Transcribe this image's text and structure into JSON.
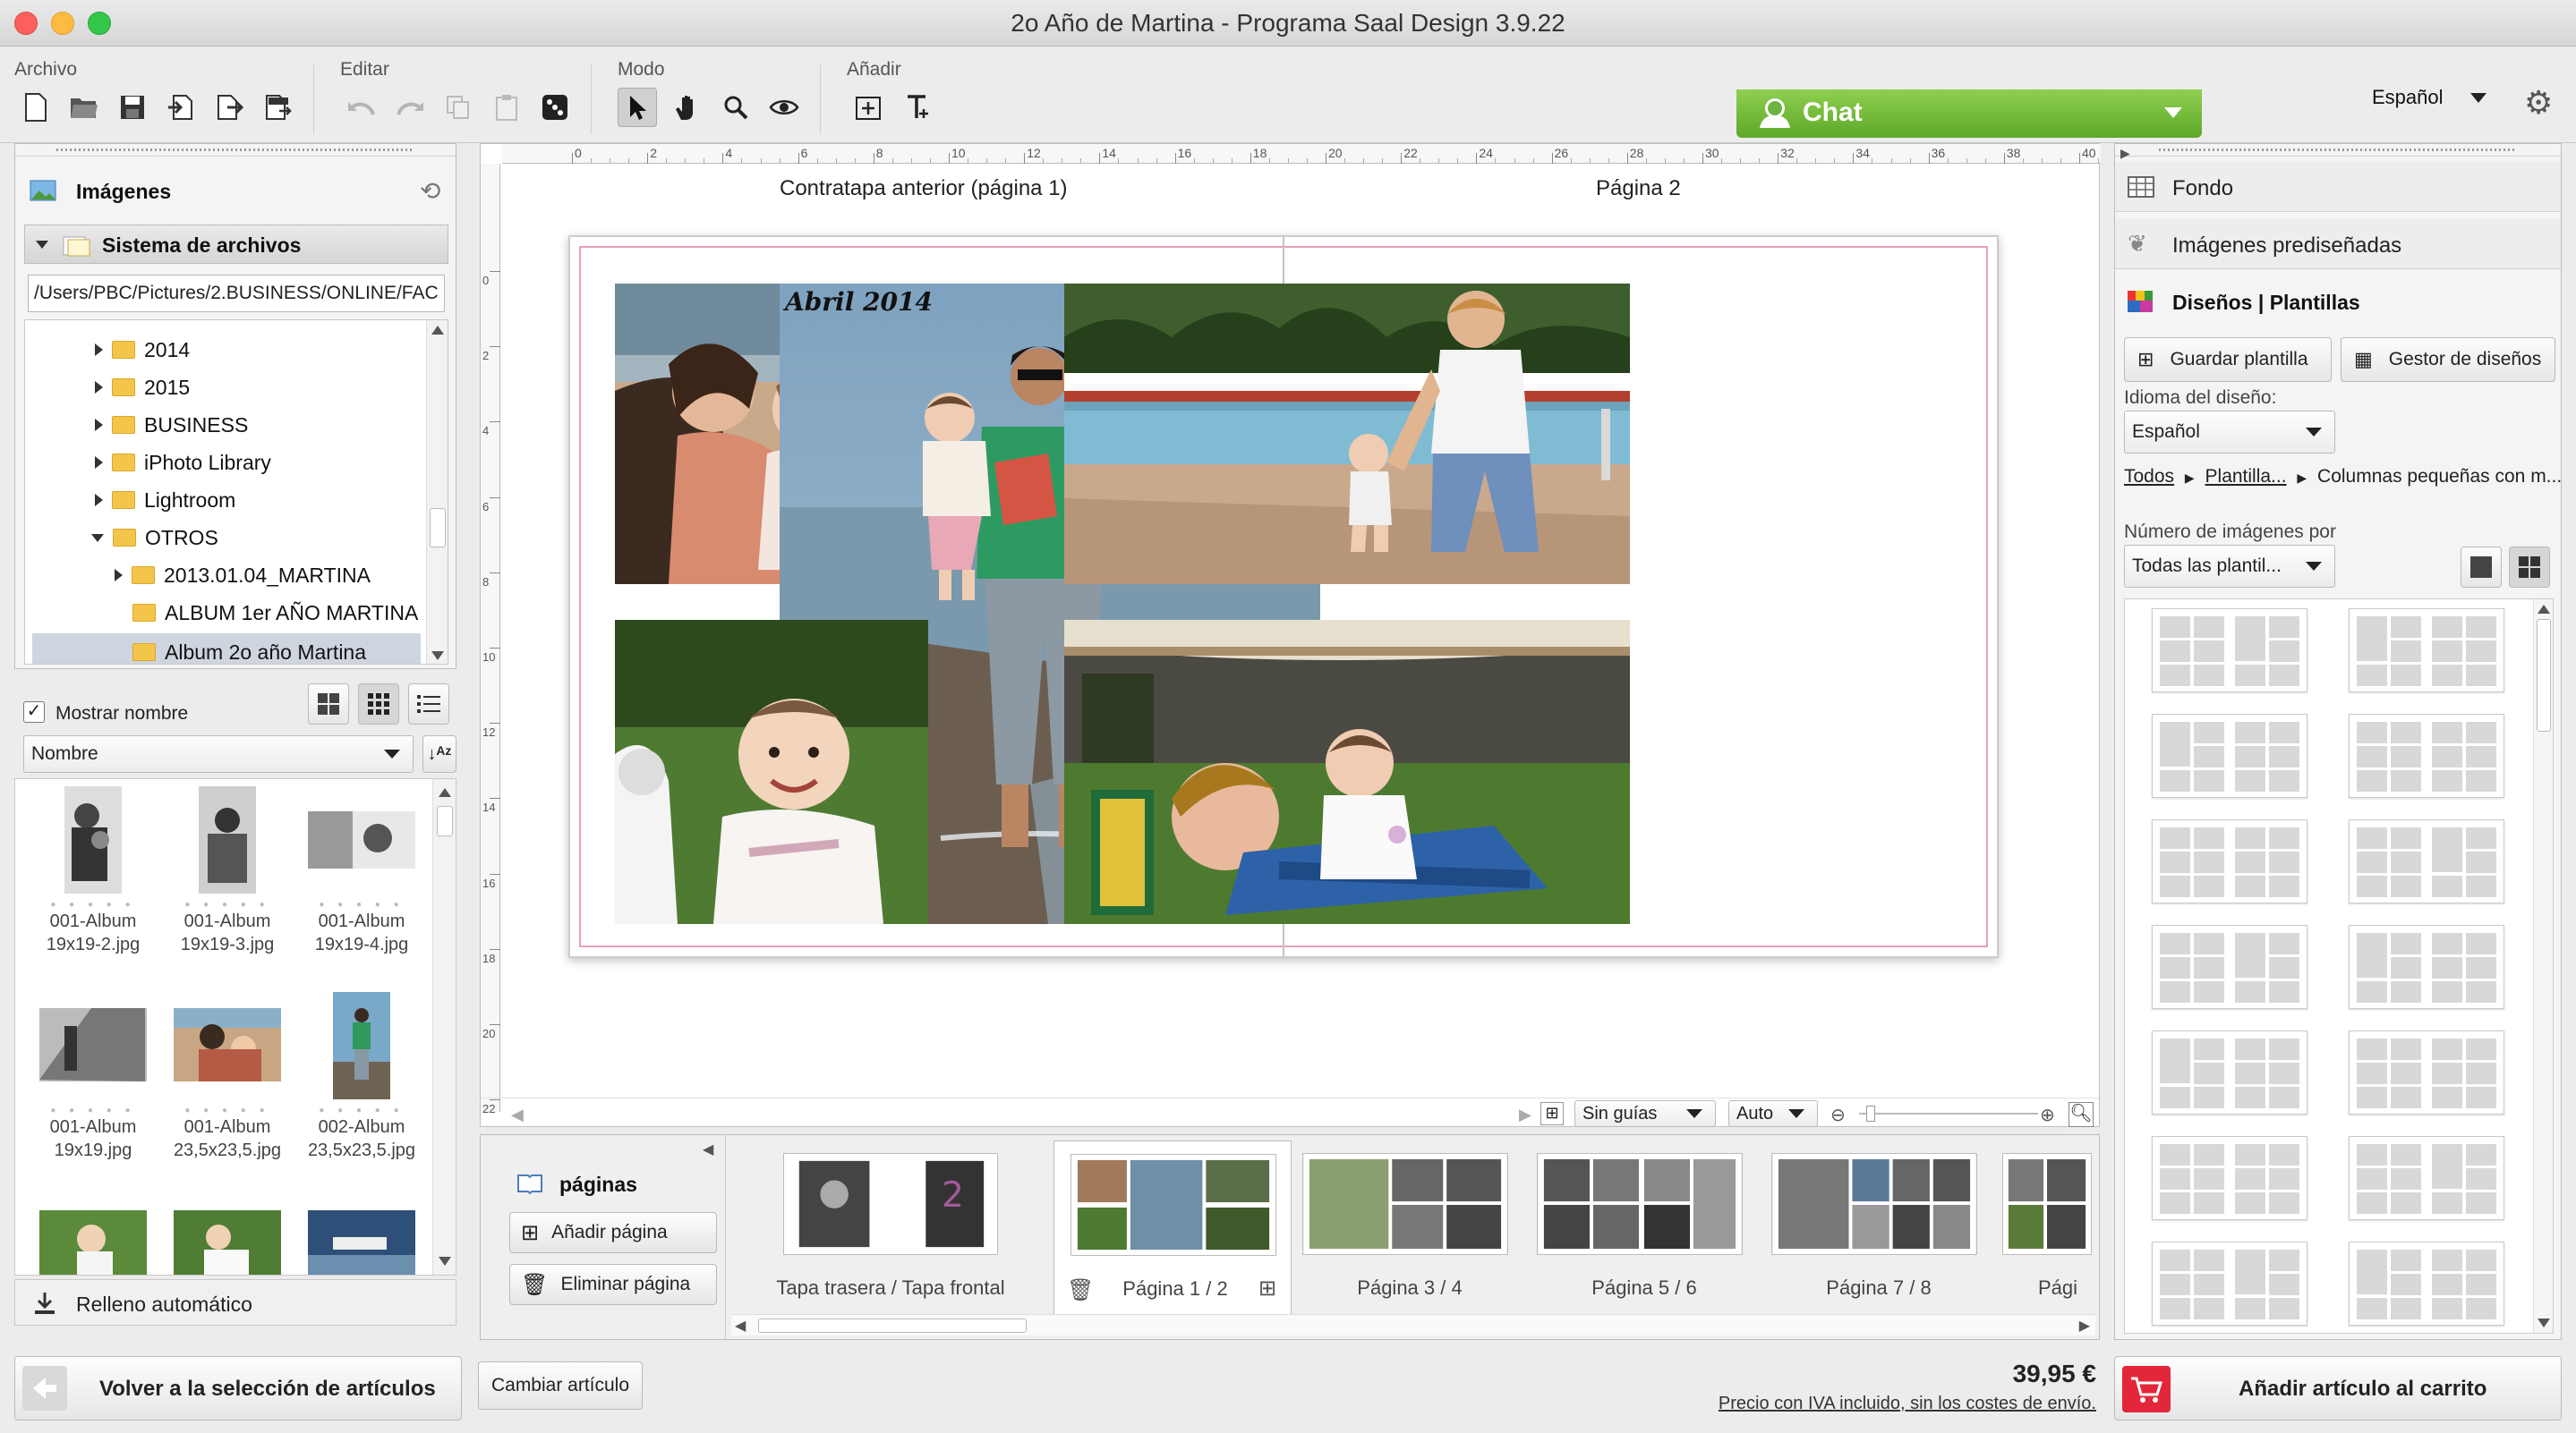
{
  "window": {
    "title": "2o Año de Martina - Programa Saal Design 3.9.22"
  },
  "toolbar": {
    "groups": {
      "archivo": "Archivo",
      "editar": "Editar",
      "modo": "Modo",
      "anadir": "Añadir"
    },
    "chat_label": "Chat",
    "language": "Español"
  },
  "left_panel": {
    "images_header": "Imágenes",
    "filesystem_header": "Sistema de archivos",
    "path": "/Users/PBC/Pictures/2.BUSINESS/ONLINE/FAC",
    "tree": [
      {
        "label": "2014",
        "expanded": false,
        "level": 1
      },
      {
        "label": "2015",
        "expanded": false,
        "level": 1
      },
      {
        "label": "BUSINESS",
        "expanded": false,
        "level": 1
      },
      {
        "label": "iPhoto Library",
        "expanded": false,
        "level": 1
      },
      {
        "label": "Lightroom",
        "expanded": false,
        "level": 1
      },
      {
        "label": "OTROS",
        "expanded": true,
        "level": 1
      },
      {
        "label": "2013.01.04_MARTINA",
        "expanded": false,
        "level": 2
      },
      {
        "label": "ALBUM 1er AÑO MARTINA",
        "expanded": null,
        "level": 2
      },
      {
        "label": "Album 2o año Martina",
        "expanded": null,
        "level": 2
      }
    ],
    "show_name_label": "Mostrar nombre",
    "show_name_checked": true,
    "sort_by": "Nombre",
    "thumbnails": [
      {
        "caption": "001-Album 19x19-2.jpg",
        "photo": "bw-man-child"
      },
      {
        "caption": "001-Album 19x19-3.jpg",
        "photo": "bw-child-chair"
      },
      {
        "caption": "001-Album 19x19-4.jpg",
        "photo": "bw-child-window"
      },
      {
        "caption": "001-Album 19x19.jpg",
        "photo": "bw-stairs"
      },
      {
        "caption": "001-Album 23,5x23,5.jpg",
        "photo": "beach-kiss"
      },
      {
        "caption": "002-Album 23,5x23,5.jpg",
        "photo": "beach-dad"
      },
      {
        "caption": "",
        "photo": "grass-baby"
      },
      {
        "caption": "",
        "photo": "grass-baby2"
      },
      {
        "caption": "",
        "photo": "pool"
      }
    ],
    "auto_fill_label": "Relleno automático",
    "back_label": "Volver a la selección de artículos"
  },
  "canvas": {
    "left_page_label": "Contratapa anterior (página 1)",
    "right_page_label": "Página 2",
    "photo_caption": "Abril 2014",
    "ruler_ticks": [
      "0",
      "2",
      "4",
      "6",
      "8",
      "10",
      "12",
      "14",
      "16",
      "18",
      "20",
      "22",
      "24",
      "26",
      "28",
      "30",
      "32",
      "34",
      "36",
      "38",
      "40"
    ],
    "vruler_ticks": [
      "0",
      "2",
      "4",
      "6",
      "8",
      "10",
      "12",
      "14",
      "16",
      "18",
      "20",
      "22"
    ],
    "guides_select": "Sin guías",
    "zoom_select": "Auto"
  },
  "pages_strip": {
    "header": "páginas",
    "add_page": "Añadir página",
    "delete_page": "Eliminar página",
    "pages": [
      {
        "label": "Tapa trasera / Tapa frontal"
      },
      {
        "label": "Página 1 / 2"
      },
      {
        "label": "Página 3 / 4"
      },
      {
        "label": "Página 5 / 6"
      },
      {
        "label": "Página 7 / 8"
      },
      {
        "label": "Pági"
      }
    ],
    "change_article": "Cambiar artículo"
  },
  "right_panel": {
    "background": "Fondo",
    "clipart": "Imágenes prediseñadas",
    "designs_header": "Diseños | Plantillas",
    "save_template": "Guardar plantilla",
    "design_manager": "Gestor de diseños",
    "design_language_label": "Idioma del diseño:",
    "design_language": "Español",
    "breadcrumb": [
      "Todos",
      "Plantilla...",
      "Columnas pequeñas con m..."
    ],
    "num_images_label": "Número de imágenes por",
    "num_images_value": "Todas las plantil...",
    "add_to_cart": "Añadir artículo al carrito"
  },
  "price": {
    "amount": "39,95 €",
    "note": "Precio con IVA incluido, sin los costes de envío."
  },
  "colors": {
    "accent_green": "#6db33f",
    "cart_red": "#e3263a",
    "page_border": "#e8a0b0"
  }
}
